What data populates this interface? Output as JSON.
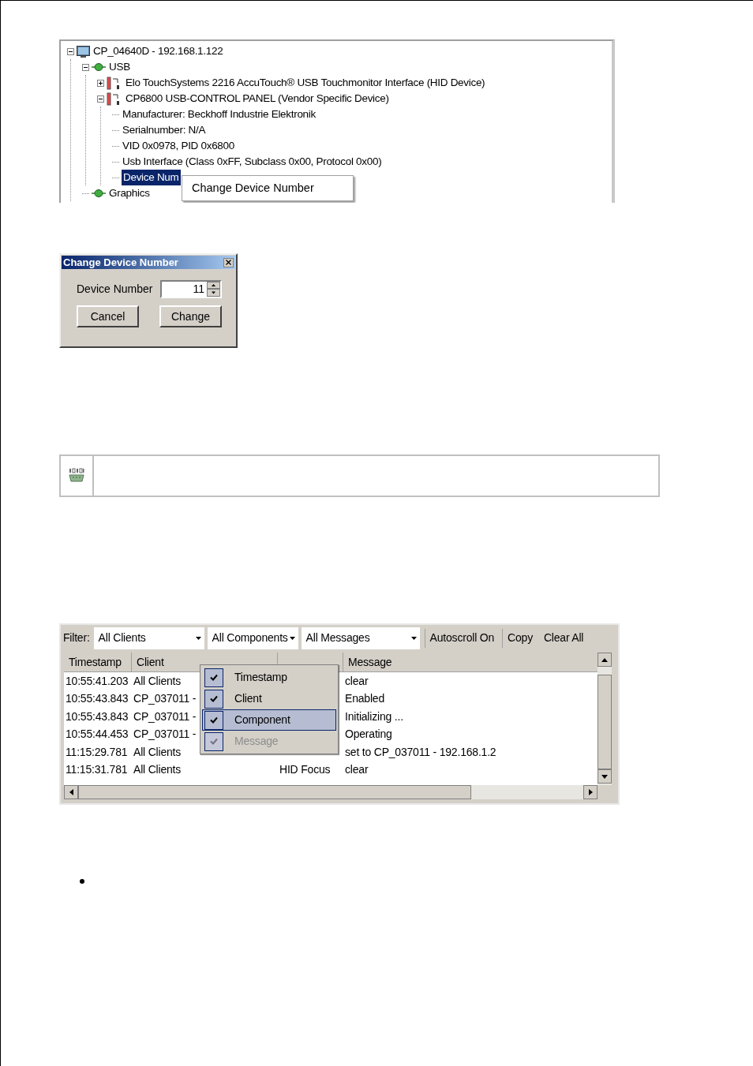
{
  "tree": {
    "nodes": [
      {
        "label": "CP_04640D - 192.168.1.122",
        "kind": "computer",
        "expanded": true,
        "selected": false,
        "children": [
          {
            "label": "USB",
            "kind": "connector",
            "expanded": true,
            "selected": false,
            "children": [
              {
                "label": "Elo TouchSystems 2216 AccuTouch® USB Touchmonitor Interface (HID Device)",
                "kind": "device",
                "expanded": false,
                "selected": false
              },
              {
                "label": "CP6800 USB-CONTROL PANEL (Vendor Specific Device)",
                "kind": "device",
                "expanded": true,
                "selected": false,
                "children": [
                  {
                    "label": "Manufacturer: Beckhoff Industrie Elektronik",
                    "selected": false
                  },
                  {
                    "label": "Serialnumber: N/A",
                    "selected": false
                  },
                  {
                    "label": "VID 0x0978, PID 0x6800",
                    "selected": false
                  },
                  {
                    "label": "Usb Interface (Class 0xFF, Subclass 0x00, Protocol 0x00)",
                    "selected": false
                  },
                  {
                    "label": "Device Num",
                    "selected": true
                  }
                ]
              }
            ]
          },
          {
            "label": "Graphics",
            "kind": "connector",
            "selected": false
          }
        ]
      }
    ]
  },
  "context_menu": {
    "items": [
      {
        "label": "Change Device Number"
      }
    ]
  },
  "dialog": {
    "title": "Change Device Number",
    "field_label": "Device Number",
    "value": "11",
    "buttons": [
      "Cancel",
      "Change"
    ]
  },
  "log": {
    "filter_label": "Filter:",
    "dropdowns": [
      "All Clients",
      "All Components",
      "All Messages"
    ],
    "buttons": [
      "Autoscroll On",
      "Copy",
      "Clear All"
    ],
    "columns": {
      "timestamp": "Timestamp",
      "client": "Client",
      "message": "Message"
    },
    "rows": [
      {
        "timestamp": "10:55:41.203",
        "client": "All Clients",
        "message": "clear"
      },
      {
        "timestamp": "10:55:43.843",
        "client": "CP_037011 -",
        "message": "Enabled"
      },
      {
        "timestamp": "10:55:43.843",
        "client": "CP_037011 -",
        "message": "Initializing ..."
      },
      {
        "timestamp": "10:55:44.453",
        "client": "CP_037011 -",
        "message": "Operating"
      },
      {
        "timestamp": "11:15:29.781",
        "client": "All Clients",
        "message": "set to CP_037011 - 192.168.1.2"
      },
      {
        "timestamp": "11:15:31.781",
        "client": "All Clients",
        "component": "HID Focus",
        "message": "clear"
      }
    ],
    "column_menu": [
      {
        "label": "Timestamp",
        "checked": true,
        "disabled": false,
        "selected": false
      },
      {
        "label": "Client",
        "checked": true,
        "disabled": false,
        "selected": false
      },
      {
        "label": "Component",
        "checked": true,
        "disabled": false,
        "selected": true
      },
      {
        "label": "Message",
        "checked": true,
        "disabled": true,
        "selected": false
      }
    ]
  }
}
